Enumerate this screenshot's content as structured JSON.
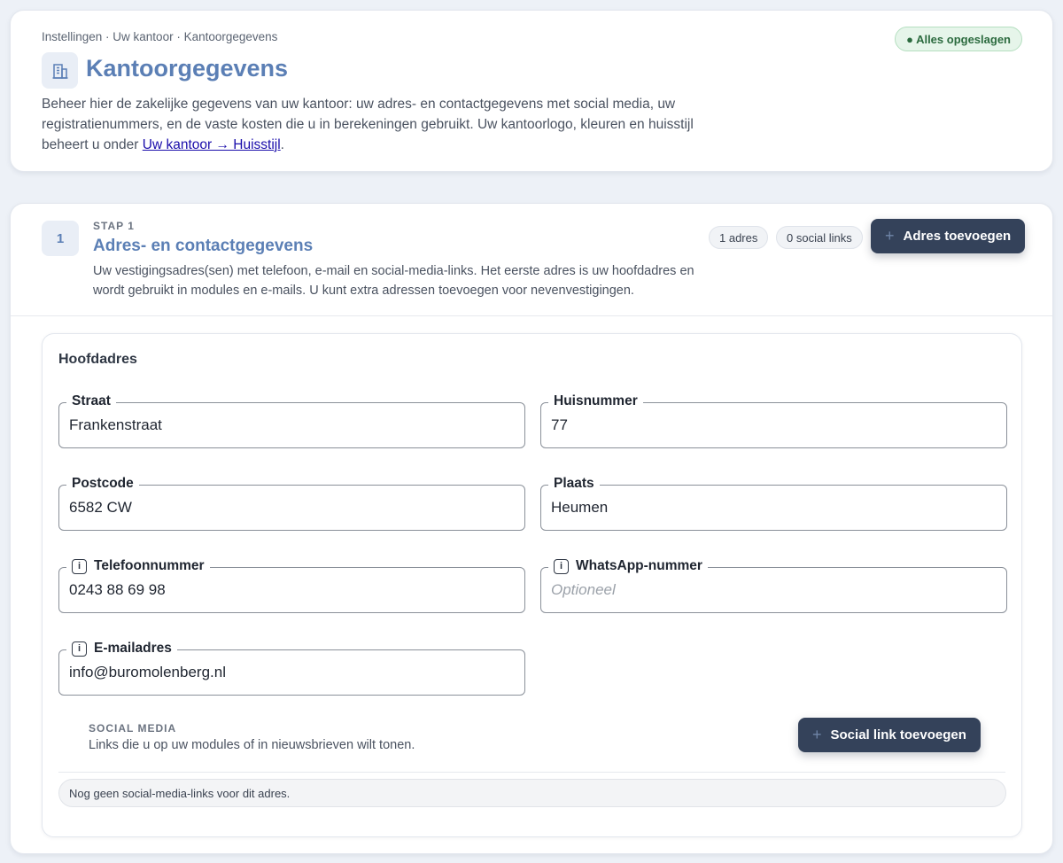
{
  "header": {
    "breadcrumb": "Instellingen · Uw kantoor · Kantoorgegevens",
    "status_badge": "● Alles opgeslagen",
    "title": "Kantoorgegevens",
    "title_icon": "building-icon",
    "intro_text": "Beheer hier de zakelijke gegevens van uw kantoor: uw adres- en contactgegevens met social media, uw registratienummers, en de vaste kosten die u in berekeningen gebruikt. Uw kantoorlogo, kleuren en huisstijl beheert u onder ",
    "intro_link": "Uw kantoor → Huisstijl",
    "intro_end": "."
  },
  "step": {
    "number": "1",
    "label": "STAP 1",
    "title": "Adres- en contactgegevens",
    "description": "Uw vestigingsadres(sen) met telefoon, e-mail en social-media-links. Het eerste adres is uw hoofdadres en wordt gebruikt in modules en e-mails. U kunt extra adressen toevoegen voor nevenvestigingen.",
    "chip_addresses": "1 adres",
    "chip_social": "0 social links",
    "add_address_label": "Adres toevoegen",
    "plus": "+"
  },
  "address": {
    "title": "Hoofdadres",
    "fields": {
      "straat": {
        "label": "Straat",
        "value": "Frankenstraat"
      },
      "huisnummer": {
        "label": "Huisnummer",
        "value": "77"
      },
      "postcode": {
        "label": "Postcode",
        "value": "6582 CW"
      },
      "plaats": {
        "label": "Plaats",
        "value": "Heumen"
      },
      "telefoon": {
        "label": "Telefoonnummer",
        "value": "0243 88 69 98"
      },
      "whatsapp": {
        "label": "WhatsApp-nummer",
        "value": "",
        "placeholder": "Optioneel"
      },
      "email": {
        "label": "E-mailadres",
        "value": "info@buromolenberg.nl"
      }
    },
    "info_glyph": "i",
    "social": {
      "title": "SOCIAL MEDIA",
      "description": "Links die u op uw modules of in nieuwsbrieven wilt tonen.",
      "add_label": "Social link toevoegen",
      "empty_text": "Nog geen social-media-links voor dit adres."
    }
  },
  "colors": {
    "accent": "#5b7fb5",
    "button_dark": "#34425a",
    "saved_green": "#2c6b3f",
    "background": "#edf1f7"
  }
}
